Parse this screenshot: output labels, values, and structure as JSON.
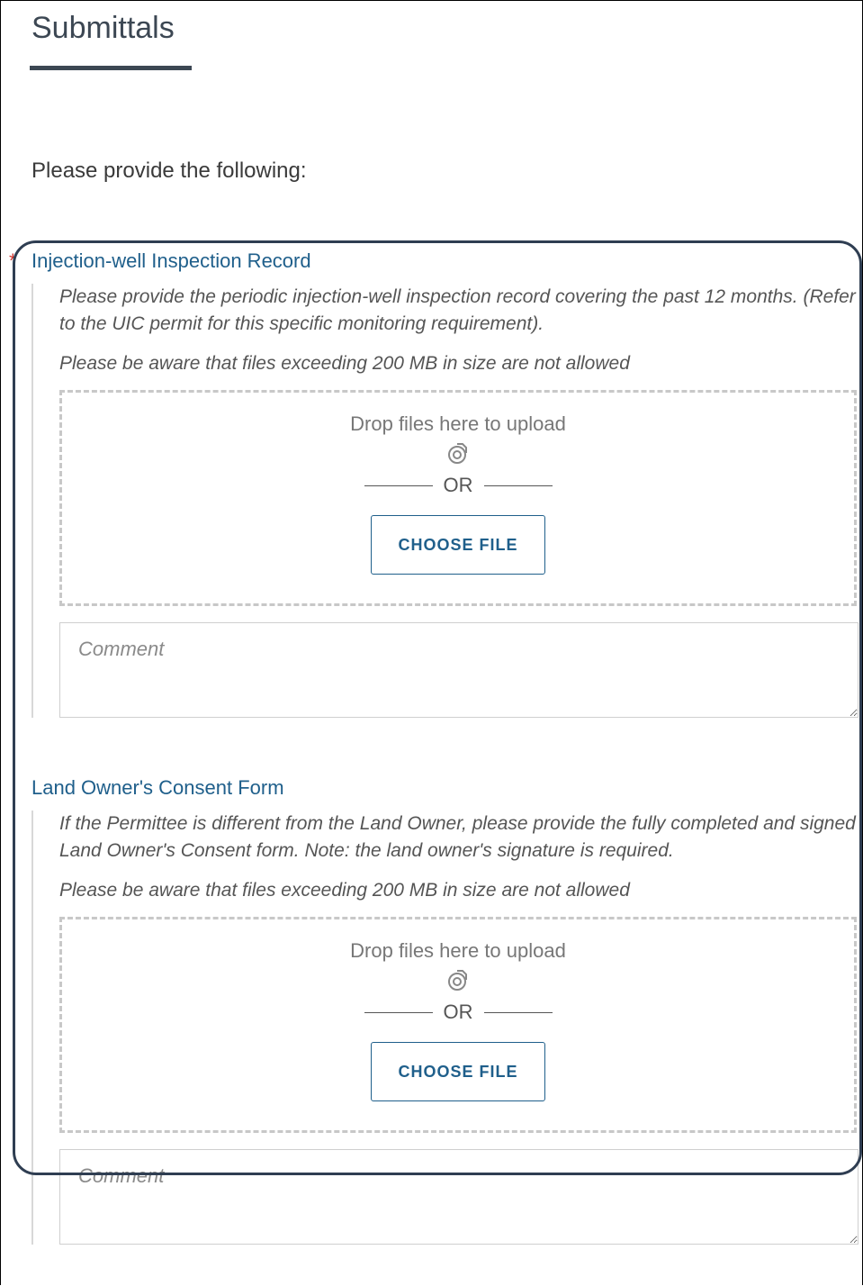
{
  "page": {
    "title": "Submittals",
    "intro": "Please provide the following:"
  },
  "sections": [
    {
      "title": "Injection-well Inspection Record",
      "required": true,
      "required_marker": "*",
      "description": "Please provide the periodic injection-well inspection record covering the past 12 months. (Refer to the UIC permit for this specific monitoring requirement).",
      "size_note": "Please be aware that files exceeding 200 MB in size are not allowed",
      "drop_label": "Drop files here to upload",
      "or_label": "OR",
      "choose_file_label": "CHOOSE FILE",
      "comment_placeholder": "Comment",
      "comment_value": ""
    },
    {
      "title": "Land Owner's Consent Form",
      "required": false,
      "description": "If the Permittee is different from the Land Owner, please provide the fully completed and signed Land Owner's Consent form. Note: the land owner's signature is required.",
      "size_note": "Please be aware that files exceeding 200 MB in size are not allowed",
      "drop_label": "Drop files here to upload",
      "or_label": "OR",
      "choose_file_label": "CHOOSE FILE",
      "comment_placeholder": "Comment",
      "comment_value": ""
    }
  ],
  "icons": {
    "upload": "upload-icon"
  },
  "colors": {
    "heading": "#3c4753",
    "section_title": "#1f5f8b",
    "required_star": "#d0342c",
    "highlight_border": "#2f3e52"
  }
}
